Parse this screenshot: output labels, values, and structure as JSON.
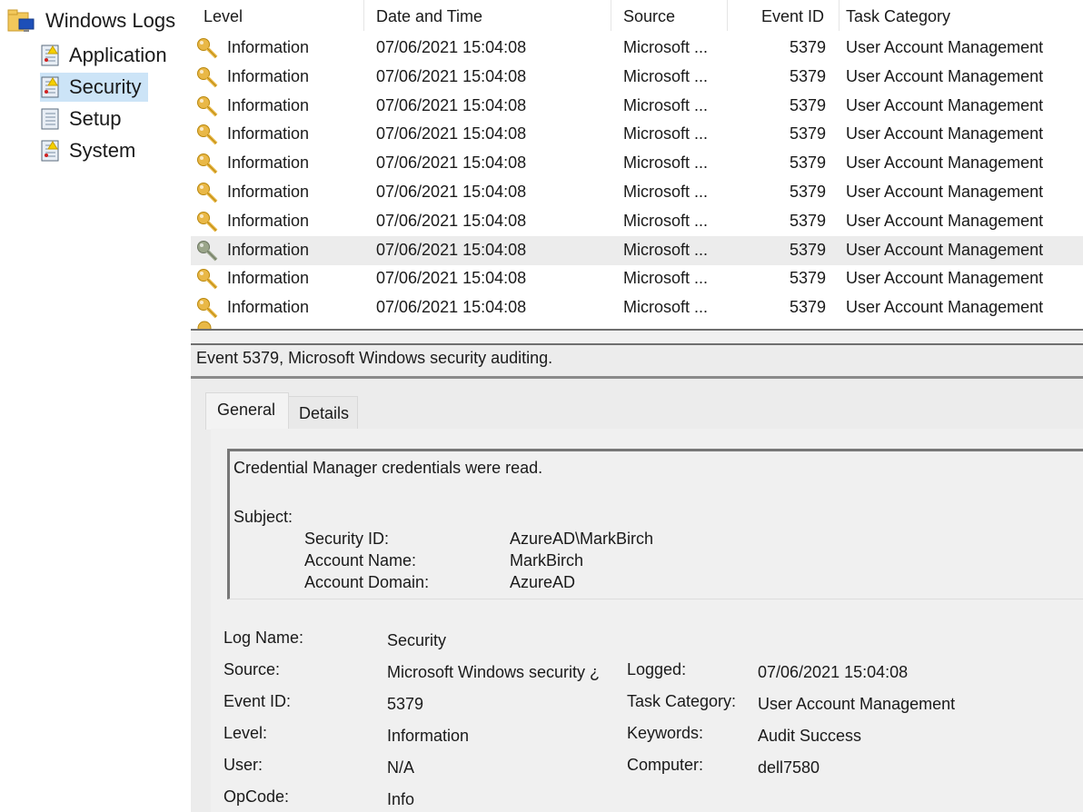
{
  "tree": {
    "root": "Windows Logs",
    "items": [
      {
        "label": "Application",
        "selected": false
      },
      {
        "label": "Security",
        "selected": true
      },
      {
        "label": "Setup",
        "selected": false
      },
      {
        "label": "System",
        "selected": false
      }
    ]
  },
  "grid": {
    "columns": [
      "Level",
      "Date and Time",
      "Source",
      "Event ID",
      "Task Category"
    ],
    "rows": [
      {
        "level": "Information",
        "datetime": "07/06/2021 15:04:08",
        "source": "Microsoft ...",
        "event_id": "5379",
        "task": "User Account Management"
      },
      {
        "level": "Information",
        "datetime": "07/06/2021 15:04:08",
        "source": "Microsoft ...",
        "event_id": "5379",
        "task": "User Account Management"
      },
      {
        "level": "Information",
        "datetime": "07/06/2021 15:04:08",
        "source": "Microsoft ...",
        "event_id": "5379",
        "task": "User Account Management"
      },
      {
        "level": "Information",
        "datetime": "07/06/2021 15:04:08",
        "source": "Microsoft ...",
        "event_id": "5379",
        "task": "User Account Management"
      },
      {
        "level": "Information",
        "datetime": "07/06/2021 15:04:08",
        "source": "Microsoft ...",
        "event_id": "5379",
        "task": "User Account Management"
      },
      {
        "level": "Information",
        "datetime": "07/06/2021 15:04:08",
        "source": "Microsoft ...",
        "event_id": "5379",
        "task": "User Account Management"
      },
      {
        "level": "Information",
        "datetime": "07/06/2021 15:04:08",
        "source": "Microsoft ...",
        "event_id": "5379",
        "task": "User Account Management"
      },
      {
        "level": "Information",
        "datetime": "07/06/2021 15:04:08",
        "source": "Microsoft ...",
        "event_id": "5379",
        "task": "User Account Management",
        "highlighted": true
      },
      {
        "level": "Information",
        "datetime": "07/06/2021 15:04:08",
        "source": "Microsoft ...",
        "event_id": "5379",
        "task": "User Account Management"
      },
      {
        "level": "Information",
        "datetime": "07/06/2021 15:04:08",
        "source": "Microsoft ...",
        "event_id": "5379",
        "task": "User Account Management"
      }
    ]
  },
  "detail": {
    "title": "Event 5379, Microsoft Windows security auditing.",
    "tabs": [
      "General",
      "Details"
    ],
    "message": {
      "headline": "Credential Manager credentials were read.",
      "subject_label": "Subject:",
      "fields": [
        {
          "label": "Security ID:",
          "value": "AzureAD\\MarkBirch"
        },
        {
          "label": "Account Name:",
          "value": "MarkBirch"
        },
        {
          "label": "Account Domain:",
          "value": "AzureAD"
        }
      ]
    },
    "left_fields": [
      {
        "label": "Log Name:",
        "value": "Security"
      },
      {
        "label": "Source:",
        "value": "Microsoft Windows security ¿"
      },
      {
        "label": "Event ID:",
        "value": "5379"
      },
      {
        "label": "Level:",
        "value": "Information"
      },
      {
        "label": "User:",
        "value": "N/A"
      },
      {
        "label": "OpCode:",
        "value": "Info"
      }
    ],
    "right_fields": [
      {
        "label": "Logged:",
        "value": "07/06/2021 15:04:08"
      },
      {
        "label": "Task Category:",
        "value": "User Account Management"
      },
      {
        "label": "Keywords:",
        "value": "Audit Success"
      },
      {
        "label": "Computer:",
        "value": "dell7580"
      }
    ]
  }
}
